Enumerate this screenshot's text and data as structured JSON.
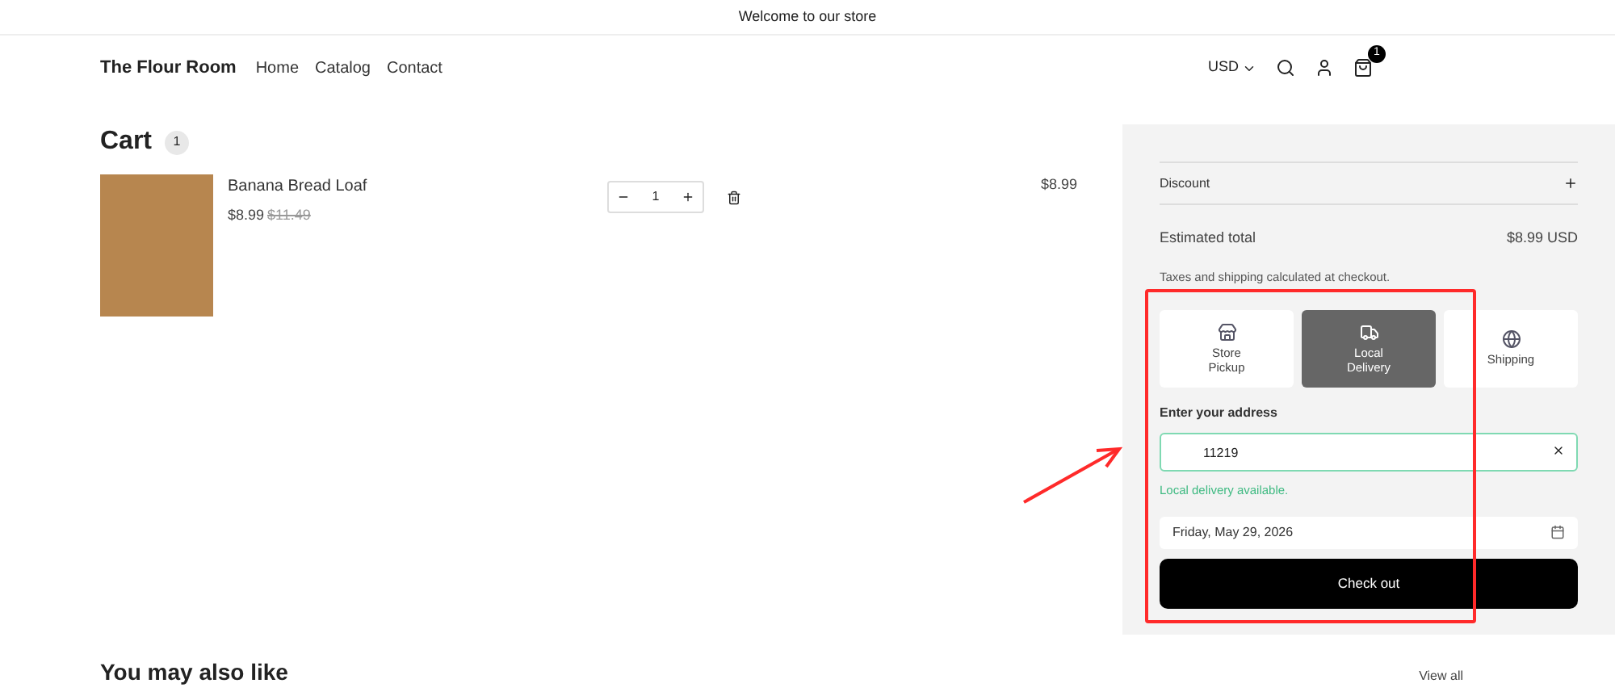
{
  "announcement": "Welcome to our store",
  "header": {
    "logo": "The Flour Room",
    "nav": [
      "Home",
      "Catalog",
      "Contact"
    ],
    "currency": "USD",
    "cart_count": "1"
  },
  "cart": {
    "title": "Cart",
    "count": "1",
    "items": [
      {
        "name": "Banana Bread Loaf",
        "price": "$8.99",
        "compare_price": "$11.49",
        "quantity": "1",
        "total": "$8.99"
      }
    ]
  },
  "summary": {
    "discount_label": "Discount",
    "estimated_label": "Estimated total",
    "estimated_value": "$8.99 USD",
    "note": "Taxes and shipping calculated at checkout.",
    "delivery_options": [
      {
        "kind": "store",
        "label": "Store\nPickup",
        "selected": false
      },
      {
        "kind": "truck",
        "label": "Local\nDelivery",
        "selected": true
      },
      {
        "kind": "globe",
        "label": "Shipping",
        "selected": false
      }
    ],
    "address_label": "Enter your address",
    "address_value": "11219",
    "availability": "Local delivery available.",
    "date_value": "Friday, May 29, 2026",
    "checkout": "Check out"
  },
  "recommendations": {
    "title": "You may also like",
    "view_all": "View all"
  }
}
